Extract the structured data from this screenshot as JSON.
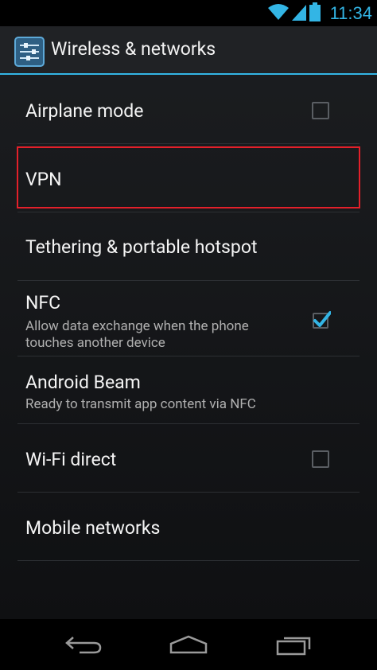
{
  "status_bar": {
    "time": "11:34",
    "icons": [
      "wifi-icon",
      "signal-icon",
      "battery-icon"
    ],
    "accent": "#33b5e5"
  },
  "action_bar": {
    "title": "Wireless & networks",
    "icon": "settings-sliders-icon"
  },
  "items": [
    {
      "label": "Airplane mode",
      "checkbox": false
    },
    {
      "label": "VPN",
      "highlighted": true
    },
    {
      "label": "Tethering & portable hotspot"
    },
    {
      "label": "NFC",
      "summary_line1": "Allow data exchange when the phone",
      "summary_line2": "touches another device",
      "checkbox": true
    },
    {
      "label": "Android Beam",
      "summary": "Ready to transmit app content via NFC"
    },
    {
      "label": "Wi-Fi direct",
      "checkbox": false
    },
    {
      "label": "Mobile networks"
    }
  ],
  "nav_bar": {
    "buttons": [
      "back-icon",
      "home-icon",
      "recent-apps-icon"
    ]
  },
  "colors": {
    "highlight": "#e3202a",
    "checkbox_checked": "#33b5e5"
  }
}
